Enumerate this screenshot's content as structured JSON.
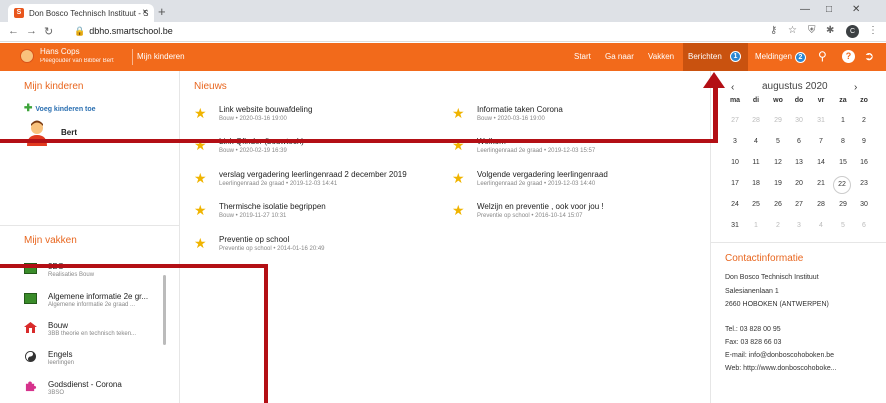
{
  "browser": {
    "tab_title": "Don Bosco Technisch Instituut - S",
    "tab_favicon": "S",
    "tab_close": "×",
    "new_tab": "+",
    "url": "dbho.smartschool.be",
    "profile_initial": "C"
  },
  "topbar": {
    "user_name": "Hans Cops",
    "user_role": "Pleegouder van Bibber Bert",
    "mijn_kinderen": "Mijn kinderen",
    "nav": [
      "Start",
      "Ga naar",
      "Vakken"
    ],
    "berichten_label": "Berichten",
    "berichten_count": "1",
    "meldingen_label": "Meldingen",
    "meldingen_count": "2",
    "accent_color": "#f26a1b"
  },
  "left": {
    "kinderen_title": "Mijn kinderen",
    "voeg_toe": "Voeg kinderen toe",
    "child_name": "Bert",
    "vakken_title": "Mijn vakken",
    "courses": [
      {
        "name": "3BO",
        "sub": "Realisaties Bouw",
        "icon": "green-board-icon"
      },
      {
        "name": "Algemene informatie 2e gr...",
        "sub": "Algemene informatie 2e graad ...",
        "icon": "green-board-icon"
      },
      {
        "name": "Bouw",
        "sub": "3BB theorie en technisch teken...",
        "icon": "house-icon"
      },
      {
        "name": "Engels",
        "sub": "leerlingen",
        "icon": "yin-yang-icon"
      },
      {
        "name": "Godsdienst - Corona",
        "sub": "3BSO",
        "icon": "puzzle-icon"
      }
    ]
  },
  "news": {
    "title": "Nieuws",
    "items": [
      {
        "title": "Link website bouwafdeling",
        "sub": "Bouw • 2020-03-16 19:00"
      },
      {
        "title": "Informatie taken Corona",
        "sub": "Bouw • 2020-03-16 19:00"
      },
      {
        "title": "Link Qfinder (bouwtech)",
        "sub": "Bouw • 2020-02-19 16:39"
      },
      {
        "title": "Welkom",
        "sub": "Leerlingenraad 2e graad • 2019-12-03 15:57"
      },
      {
        "title": "verslag vergadering leerlingenraad 2 december 2019",
        "sub": "Leerlingenraad 2e graad • 2019-12-03 14:41"
      },
      {
        "title": "Volgende vergadering leerlingenraad",
        "sub": "Leerlingenraad 2e graad • 2019-12-03 14:40"
      },
      {
        "title": "Thermische isolatie begrippen",
        "sub": "Bouw • 2019-11-27 10:31"
      },
      {
        "title": "Welzijn en preventie , ook voor jou !",
        "sub": "Preventie op school • 2016-10-14 15:07"
      },
      {
        "title": "Preventie op school",
        "sub": "Preventie op school • 2014-01-16 20:49"
      }
    ]
  },
  "calendar": {
    "prev": "‹",
    "next": "›",
    "month": "augustus 2020",
    "dow": [
      "ma",
      "di",
      "wo",
      "do",
      "vr",
      "za",
      "zo"
    ],
    "weeks": [
      [
        "27",
        "28",
        "29",
        "30",
        "31",
        "1",
        "2"
      ],
      [
        "3",
        "4",
        "5",
        "6",
        "7",
        "8",
        "9"
      ],
      [
        "10",
        "11",
        "12",
        "13",
        "14",
        "15",
        "16"
      ],
      [
        "17",
        "18",
        "19",
        "20",
        "21",
        "22",
        "23"
      ],
      [
        "24",
        "25",
        "26",
        "27",
        "28",
        "29",
        "30"
      ],
      [
        "31",
        "1",
        "2",
        "3",
        "4",
        "5",
        "6"
      ]
    ],
    "today": "22"
  },
  "contact": {
    "title": "Contactinformatie",
    "lines": [
      "Don Bosco Technisch Instituut",
      "Salesianenlaan 1",
      "2660 HOBOKEN (ANTWERPEN)",
      "Tel.: 03 828 00 95",
      "Fax: 03 828 66 03",
      "E-mail: info@donboscohoboken.be",
      "Web: http://www.donboscohoboke..."
    ]
  }
}
